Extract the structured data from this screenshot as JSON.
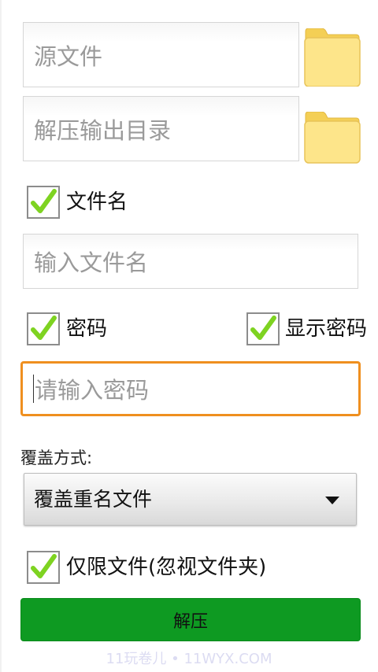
{
  "source_field": {
    "placeholder": "源文件"
  },
  "output_field": {
    "placeholder": "解压输出目录"
  },
  "filename_option": {
    "label": "文件名",
    "checked": true,
    "input_placeholder": "输入文件名"
  },
  "password_option": {
    "label": "密码",
    "checked": true
  },
  "show_password_option": {
    "label": "显示密码",
    "checked": true
  },
  "password_field": {
    "placeholder": "请输入密码"
  },
  "overwrite": {
    "label": "覆盖方式:",
    "selected": "覆盖重名文件"
  },
  "files_only_option": {
    "label": "仅限文件(忽视文件夹)",
    "checked": true
  },
  "extract_button": {
    "label": "解压"
  },
  "watermark": "11玩卷儿 • 11WYX.COM",
  "colors": {
    "accent_orange": "#ef8f1f",
    "button_green": "#0e9a22",
    "check_green": "#7ed321",
    "folder_yellow": "#fde58a"
  }
}
